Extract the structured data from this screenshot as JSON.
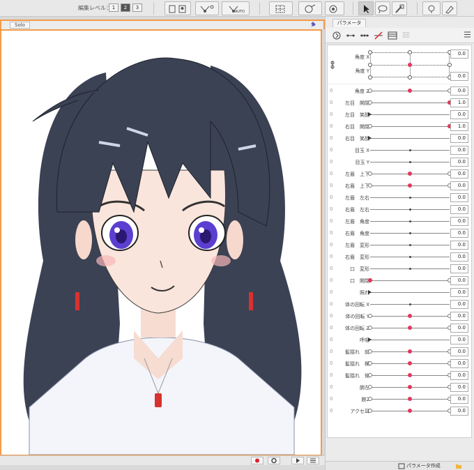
{
  "toolbar": {
    "edit_level_label": "編集レベル：",
    "levels": [
      "1",
      "2",
      "3"
    ],
    "active_level": "2",
    "auto_label": "AUTO"
  },
  "view": {
    "solo_label": "Solo"
  },
  "panel": {
    "tab_label": "パラメータ",
    "create_label": "パラメータ作成",
    "xy_param": {
      "name_x": "角度 X",
      "name_y": "角度 Y",
      "value_x": "0.0",
      "value_y": "0.0"
    },
    "params": [
      {
        "name": "角度 Z",
        "value": "0.0",
        "knob": 0.5,
        "style": "red",
        "ends": true
      },
      {
        "name": "左目　開閉",
        "value": "1.0",
        "knob": 1.0,
        "style": "red",
        "ends": true
      },
      {
        "name": "左目　笑顔",
        "value": "0.0",
        "knob": 0.0,
        "style": "tri",
        "ends": false
      },
      {
        "name": "右目　開閉",
        "value": "1.0",
        "knob": 1.0,
        "style": "red",
        "ends": true
      },
      {
        "name": "右目　笑顔",
        "value": "0.0",
        "knob": 0.0,
        "style": "tri",
        "ends": false
      },
      {
        "name": "目玉 X",
        "value": "0.0",
        "knob": 0.5,
        "style": "dark",
        "ends": false
      },
      {
        "name": "目玉 Y",
        "value": "0.0",
        "knob": 0.5,
        "style": "dark",
        "ends": false
      },
      {
        "name": "左眉　上下",
        "value": "0.0",
        "knob": 0.5,
        "style": "red",
        "ends": true
      },
      {
        "name": "右眉　上下",
        "value": "0.0",
        "knob": 0.5,
        "style": "red",
        "ends": true
      },
      {
        "name": "左眉　左右",
        "value": "0.0",
        "knob": 0.5,
        "style": "dark",
        "ends": false
      },
      {
        "name": "右眉　左右",
        "value": "0.0",
        "knob": 0.5,
        "style": "dark",
        "ends": false
      },
      {
        "name": "左眉　角度",
        "value": "0.0",
        "knob": 0.5,
        "style": "dark",
        "ends": false
      },
      {
        "name": "右眉　角度",
        "value": "0.0",
        "knob": 0.5,
        "style": "dark",
        "ends": false
      },
      {
        "name": "左眉　変形",
        "value": "0.0",
        "knob": 0.5,
        "style": "dark",
        "ends": false
      },
      {
        "name": "右眉　変形",
        "value": "0.0",
        "knob": 0.5,
        "style": "dark",
        "ends": false
      },
      {
        "name": "口　変形",
        "value": "0.0",
        "knob": 0.5,
        "style": "dark",
        "ends": false
      },
      {
        "name": "口　開閉",
        "value": "0.0",
        "knob": 0.0,
        "style": "red",
        "ends": true
      },
      {
        "name": "照れ",
        "value": "0.0",
        "knob": 0.0,
        "style": "tri",
        "ends": false
      },
      {
        "name": "体の回転 X",
        "value": "0.0",
        "knob": 0.5,
        "style": "dark",
        "ends": false
      },
      {
        "name": "体の回転 Y",
        "value": "0.0",
        "knob": 0.5,
        "style": "red",
        "ends": true
      },
      {
        "name": "体の回転 Z",
        "value": "0.0",
        "knob": 0.5,
        "style": "red",
        "ends": true
      },
      {
        "name": "呼吸",
        "value": "0.0",
        "knob": 0.0,
        "style": "tri",
        "ends": false
      },
      {
        "name": "髪揺れ　前",
        "value": "0.0",
        "knob": 0.5,
        "style": "red",
        "ends": true
      },
      {
        "name": "髪揺れ　横",
        "value": "0.0",
        "knob": 0.5,
        "style": "red",
        "ends": true
      },
      {
        "name": "髪揺れ　後",
        "value": "0.0",
        "knob": 0.5,
        "style": "red",
        "ends": true
      },
      {
        "name": "腕左",
        "value": "0.0",
        "knob": 0.5,
        "style": "red",
        "ends": true
      },
      {
        "name": "腕2",
        "value": "0.0",
        "knob": 0.5,
        "style": "red",
        "ends": true
      },
      {
        "name": "アクセ耳",
        "value": "0.0",
        "knob": 0.5,
        "style": "red",
        "ends": true
      }
    ]
  },
  "colors": {
    "accent_orange": "#f29b4a",
    "knob_red": "#e4365d",
    "hair": "#3b4254",
    "eye": "#5b3fd0"
  }
}
